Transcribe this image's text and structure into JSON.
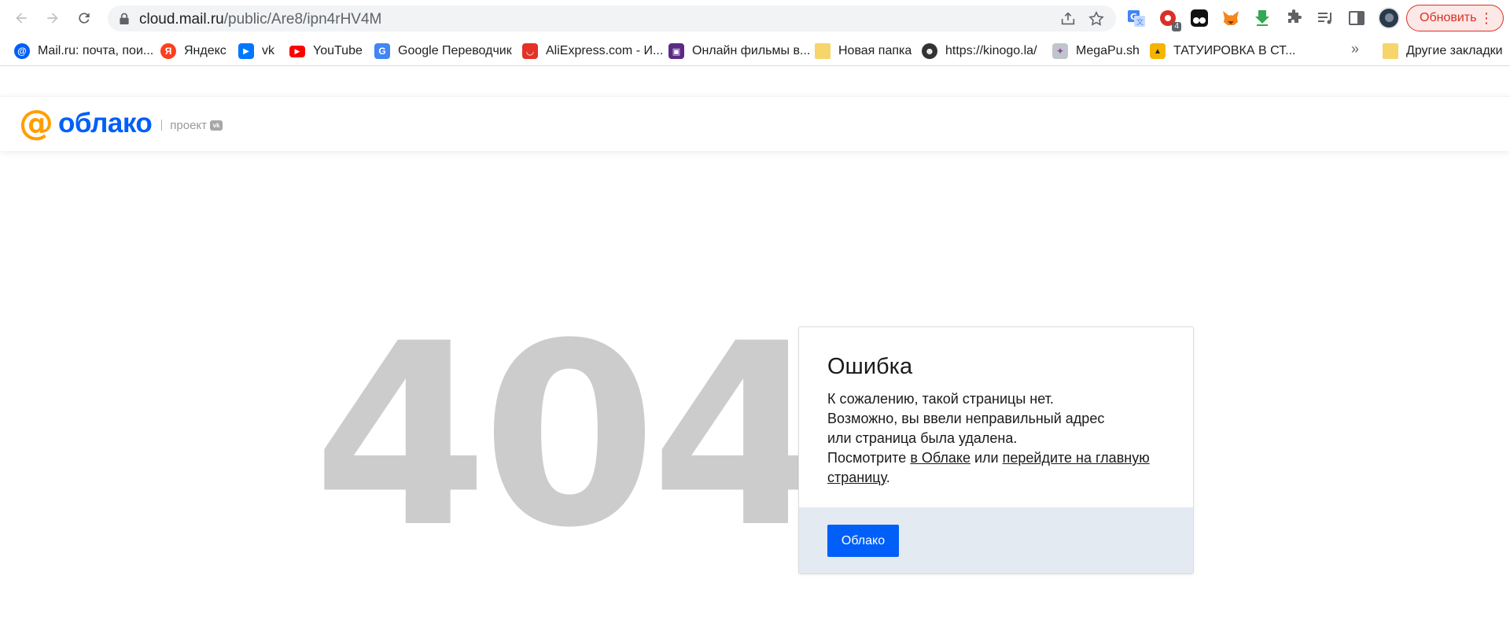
{
  "browser": {
    "url_host": "cloud.mail.ru",
    "url_path": "/public/Are8/ipn4rHV4M",
    "update_label": "Обновить",
    "more_dots": "⋮",
    "extensions_badge": "4",
    "bookmarks": [
      {
        "label": "Mail.ru: почта, пои...",
        "icon": "mailru-icon",
        "color": "#005ff9",
        "glyph": "@"
      },
      {
        "label": "Яндекс",
        "icon": "yandex-icon",
        "color": "#fc3f1d",
        "glyph": "Я"
      },
      {
        "label": "vk",
        "icon": "vk-play-icon",
        "color": "#0077ff",
        "glyph": "▶"
      },
      {
        "label": "YouTube",
        "icon": "youtube-icon",
        "color": "#ff0000",
        "glyph": "▶"
      },
      {
        "label": "Google Переводчик",
        "icon": "google-translate-icon",
        "color": "#4285f4",
        "glyph": "G"
      },
      {
        "label": "AliExpress.com - И...",
        "icon": "aliexpress-icon",
        "color": "#e43225",
        "glyph": "◡"
      },
      {
        "label": "Онлайн фильмы в...",
        "icon": "film-icon",
        "color": "#5b2a86",
        "glyph": "▣"
      },
      {
        "label": "Новая папка",
        "icon": "folder-icon",
        "color": "#f6d56b",
        "glyph": ""
      },
      {
        "label": "https://kinogo.la/",
        "icon": "kinogo-icon",
        "color": "#333333",
        "glyph": "☻"
      },
      {
        "label": "MegaPu.sh",
        "icon": "megapush-icon",
        "color": "#c0c4cc",
        "glyph": "✦"
      },
      {
        "label": "ТАТУИРОВКА В СТ...",
        "icon": "tattoo-image-icon",
        "color": "#f4b400",
        "glyph": "▲"
      },
      {
        "label": "Другие закладки",
        "icon": "folder-icon",
        "color": "#f6d56b",
        "glyph": ""
      }
    ],
    "bookmarks_more": "»"
  },
  "page": {
    "logo_text": "облако",
    "logo_at": "@",
    "logo_project": "проект",
    "logo_vk": "vk",
    "error_code": "404",
    "card": {
      "title": "Ошибка",
      "line1": "К сожалению, такой страницы нет.",
      "line2": "Возможно, вы ввели неправильный адрес",
      "line3": "или страница была удалена.",
      "line4_prefix": "Посмотрите ",
      "link1": "в Облаке",
      "line4_mid": " или ",
      "link2": "перейдите на главную страницу",
      "line4_suffix": ".",
      "button": "Облако"
    }
  },
  "colors": {
    "accent_blue": "#005ff9",
    "accent_orange": "#ff9e00",
    "update_red": "#d93025",
    "gray_404": "#cccccc",
    "footer_bg": "#e4eaf2"
  }
}
